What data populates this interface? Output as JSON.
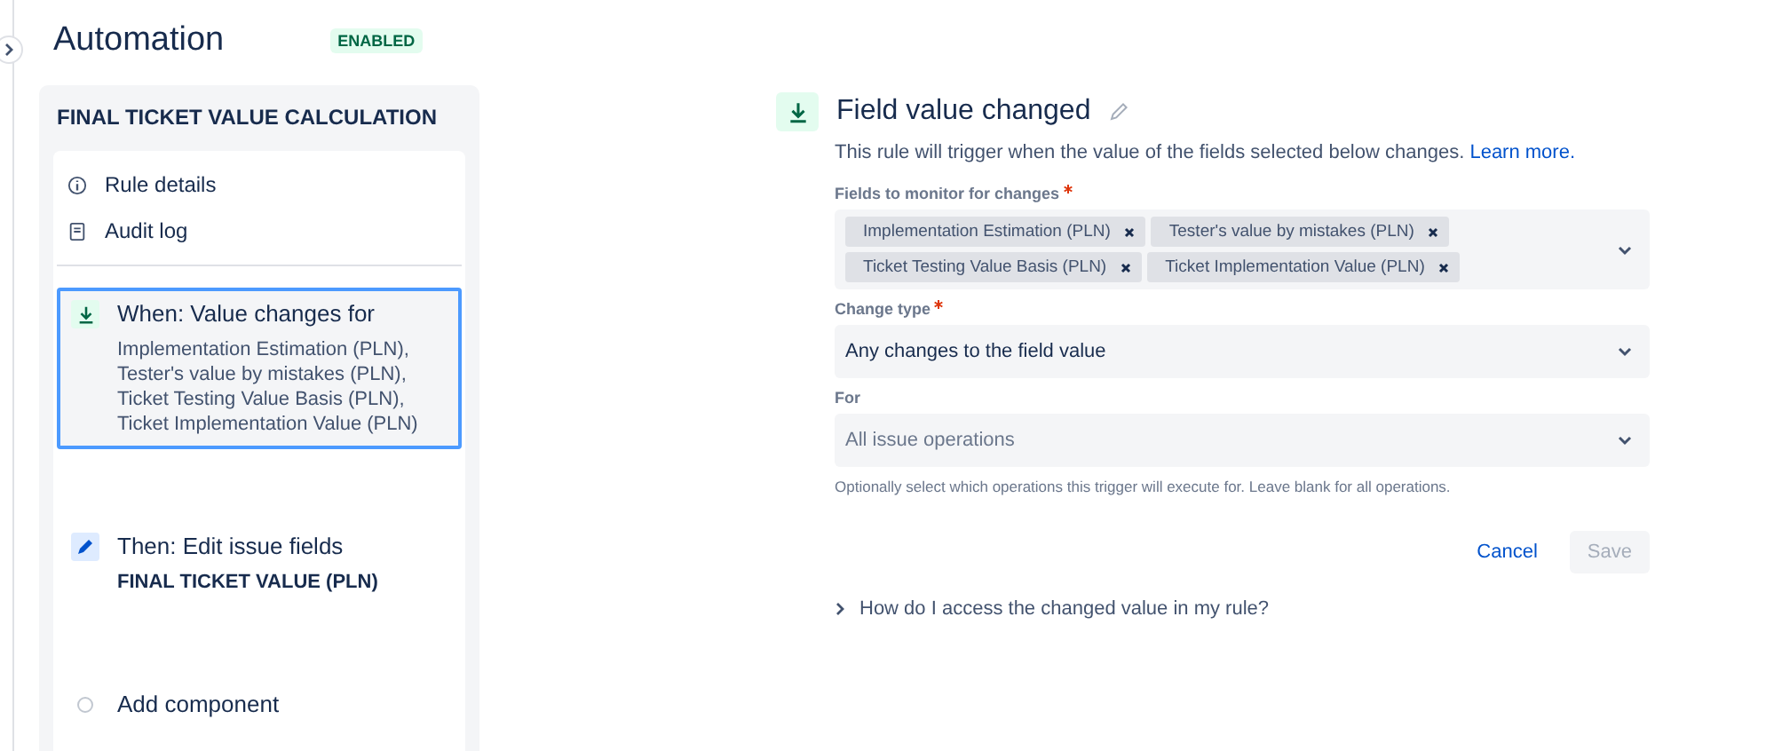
{
  "header": {
    "title": "Automation",
    "status": "ENABLED"
  },
  "rule": {
    "name": "FINAL TICKET VALUE CALCULATION",
    "links": [
      {
        "kind": "info",
        "label": "Rule details"
      },
      {
        "kind": "log",
        "label": "Audit log"
      }
    ],
    "steps": [
      {
        "kind": "trigger",
        "title": "When: Value changes for",
        "detail": "Implementation Estimation (PLN), Tester's value by mistakes (PLN), Ticket Testing Value Basis (PLN), Ticket Implementation Value (PLN)",
        "selected": true
      },
      {
        "kind": "action",
        "title": "Then: Edit issue fields",
        "detail": "FINAL TICKET VALUE (PLN)",
        "selected": false
      },
      {
        "kind": "add",
        "title": "Add component",
        "selected": false
      }
    ]
  },
  "editor": {
    "title": "Field value changed",
    "description": "This rule will trigger when the value of the fields selected below changes.",
    "link": "Learn more.",
    "fields": {
      "label": "Fields to monitor for changes",
      "required": true,
      "tags": [
        "Implementation Estimation (PLN)",
        "Tester's value by mistakes (PLN)",
        "Ticket Testing Value Basis (PLN)",
        "Ticket Implementation Value (PLN)"
      ]
    },
    "change_type": {
      "label": "Change type",
      "required": true,
      "value": "Any changes to the field value"
    },
    "for": {
      "label": "For",
      "required": false,
      "placeholder": "All issue operations",
      "help": "Optionally select which operations this trigger will execute for. Leave blank for all operations."
    },
    "buttons": [
      {
        "kind": "link",
        "label": "Cancel",
        "disabled": false
      },
      {
        "kind": "primary",
        "label": "Save",
        "disabled": true
      }
    ],
    "faq": "How do I access the changed value in my rule?"
  }
}
